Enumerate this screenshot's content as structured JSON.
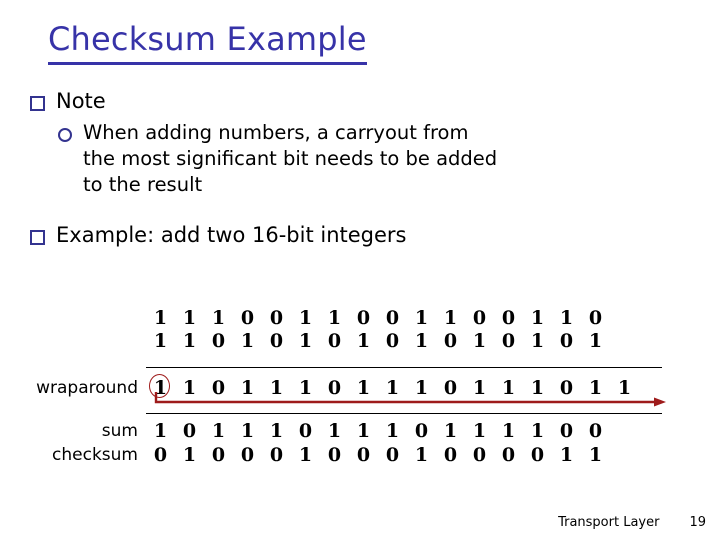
{
  "slide": {
    "title": "Checksum Example",
    "title_color": "#3733a8",
    "bullets": [
      {
        "marker": "square-bullet-icon",
        "text": "Note"
      },
      {
        "marker": "circle-bullet-icon",
        "text": "When adding numbers, a carryout from the most significant bit needs to be added to the result"
      },
      {
        "marker": "square-bullet-icon",
        "text": "Example: add two 16-bit integers"
      }
    ]
  },
  "calculation": {
    "rows": [
      {
        "label": "",
        "carry": "",
        "bits": [
          "1",
          "1",
          "1",
          "0",
          "0",
          "1",
          "1",
          "0",
          "0",
          "1",
          "1",
          "0",
          "0",
          "1",
          "1",
          "0"
        ]
      },
      {
        "label": "",
        "carry": "",
        "bits": [
          "1",
          "1",
          "0",
          "1",
          "0",
          "1",
          "0",
          "1",
          "0",
          "1",
          "0",
          "1",
          "0",
          "1",
          "0",
          "1"
        ]
      },
      {
        "label": "wraparound",
        "carry": "1",
        "bits": [
          "1",
          "0",
          "1",
          "1",
          "1",
          "0",
          "1",
          "1",
          "1",
          "0",
          "1",
          "1",
          "1",
          "0",
          "1",
          "1"
        ]
      },
      {
        "label": "sum",
        "carry": "",
        "bits": [
          "1",
          "0",
          "1",
          "1",
          "1",
          "0",
          "1",
          "1",
          "1",
          "0",
          "1",
          "1",
          "1",
          "1",
          "0",
          "0"
        ]
      },
      {
        "label": "checksum",
        "carry": "",
        "bits": [
          "0",
          "1",
          "0",
          "0",
          "0",
          "1",
          "0",
          "0",
          "0",
          "1",
          "0",
          "0",
          "0",
          "0",
          "1",
          "1"
        ]
      }
    ],
    "annotation_color": "#9e1b1b"
  },
  "footer": {
    "section": "Transport Layer",
    "page": "19"
  }
}
